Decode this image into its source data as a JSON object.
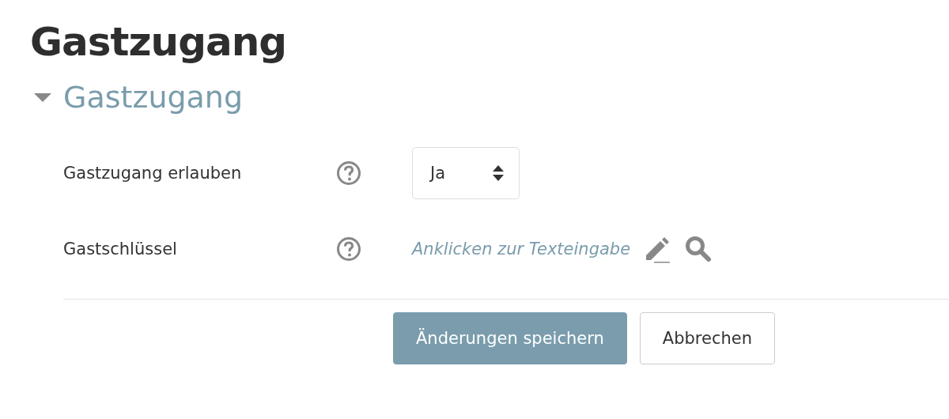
{
  "page_title": "Gastzugang",
  "section": {
    "title": "Gastzugang",
    "expanded": true,
    "rows": [
      {
        "kind": "select",
        "label": "Gastzugang erlauben",
        "value": "Ja"
      },
      {
        "kind": "inline-edit",
        "label": "Gastschlüssel",
        "link": "Anklicken zur Texteingabe"
      }
    ]
  },
  "buttons": [
    {
      "label": "Änderungen speichern",
      "kind": "primary"
    },
    {
      "label": "Abbrechen",
      "kind": "secondary"
    }
  ]
}
